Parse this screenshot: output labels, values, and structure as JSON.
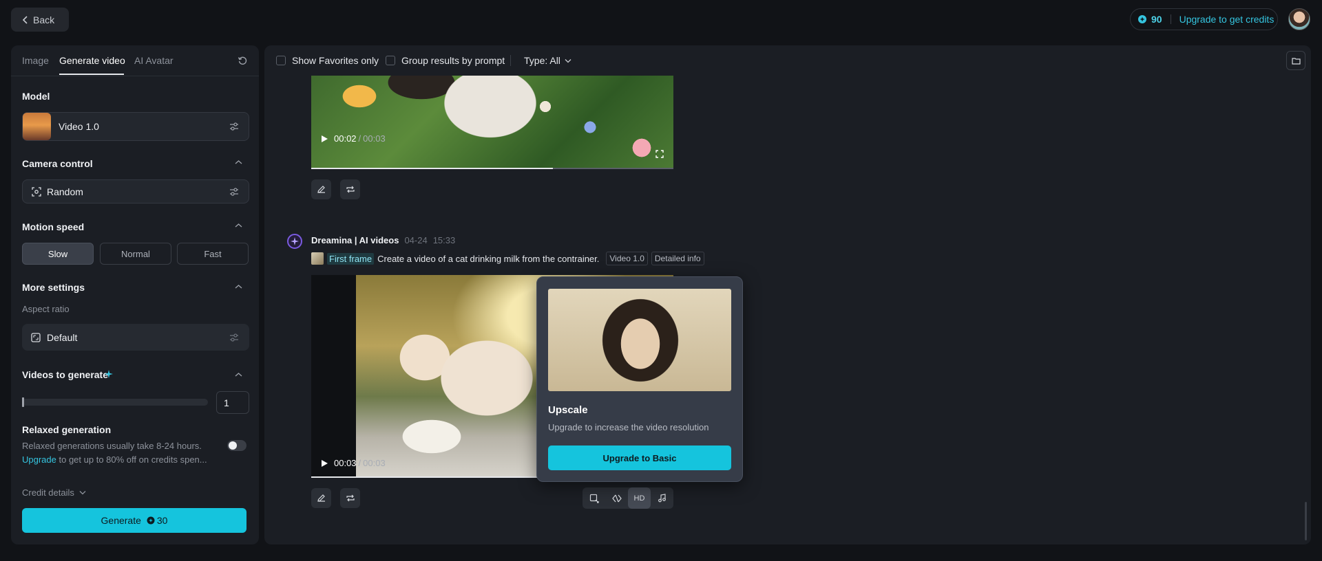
{
  "header": {
    "back_label": "Back",
    "credits": "90",
    "upgrade_label": "Upgrade to get credits"
  },
  "left": {
    "tabs": [
      {
        "label": "Image"
      },
      {
        "label": "Generate video"
      },
      {
        "label": "AI Avatar"
      }
    ],
    "model": {
      "title": "Model",
      "value": "Video 1.0"
    },
    "camera": {
      "title": "Camera control",
      "value": "Random"
    },
    "motion": {
      "title": "Motion speed",
      "options": [
        "Slow",
        "Normal",
        "Fast"
      ],
      "selected": "Slow"
    },
    "more": {
      "title": "More settings",
      "aspect_label": "Aspect ratio",
      "aspect_value": "Default"
    },
    "videos": {
      "title": "Videos to generate",
      "count": "1"
    },
    "relaxed": {
      "title": "Relaxed generation",
      "desc": "Relaxed generations usually take 8-24 hours.",
      "link": "Upgrade",
      "link_rest": "to get up to 80% off on credits spen...",
      "enabled": false
    },
    "credit_details": "Credit details",
    "generate": {
      "label": "Generate",
      "cost": "30"
    }
  },
  "filters": {
    "favorites": "Show Favorites only",
    "group": "Group results by prompt",
    "type": "Type: All"
  },
  "top_video": {
    "time": "00:02",
    "duration": "00:03"
  },
  "post": {
    "author": "Dreamina | AI videos",
    "date": "04-24",
    "time": "15:33",
    "frame_label": "First frame",
    "prompt": "Create a video of a cat drinking milk from the contrainer.",
    "model_tag": "Video 1.0",
    "info_tag": "Detailed info",
    "video": {
      "time": "00:03",
      "duration": "00:03"
    },
    "toolbar": {
      "hd": "HD"
    }
  },
  "upscale": {
    "title": "Upscale",
    "desc": "Upgrade to increase the video resolution",
    "button": "Upgrade to Basic"
  }
}
